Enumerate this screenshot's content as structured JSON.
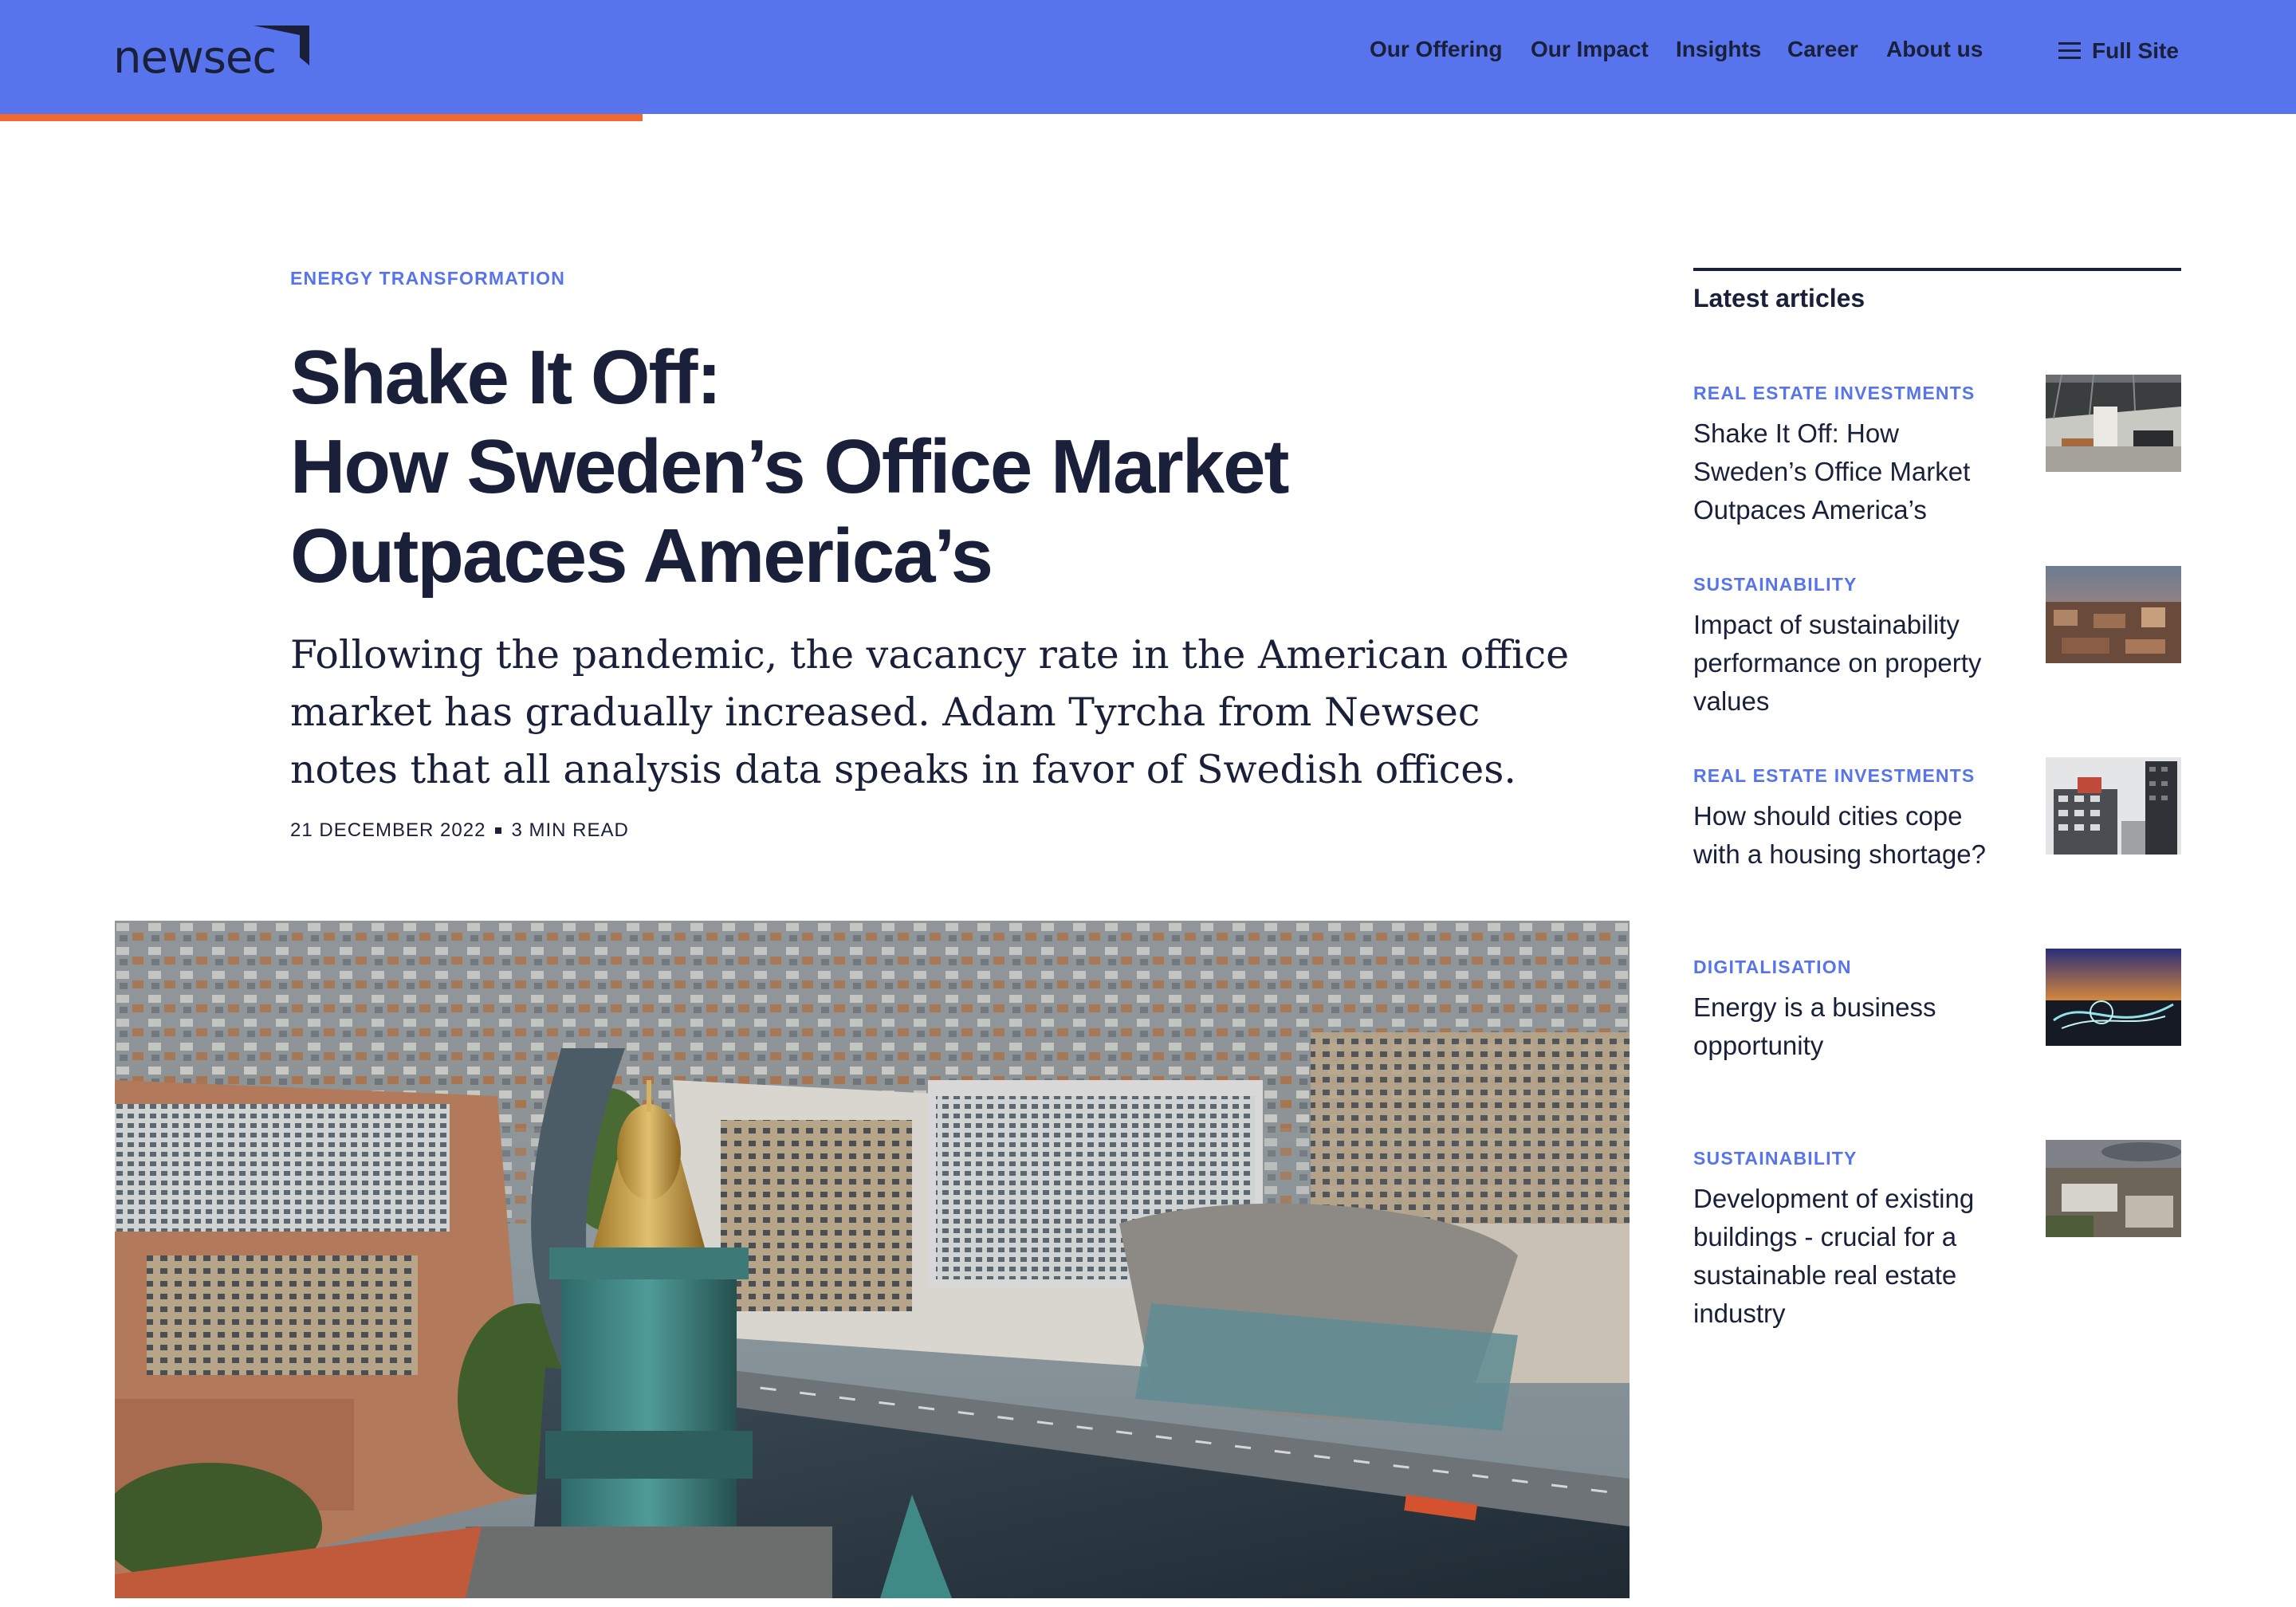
{
  "header": {
    "logo_text": "newsec",
    "nav": [
      {
        "label": "Our Offering"
      },
      {
        "label": "Our Impact"
      },
      {
        "label": "Insights"
      },
      {
        "label": "Career"
      },
      {
        "label": "About us"
      }
    ],
    "full_site_label": "Full Site",
    "menu_icon": "hamburger-icon",
    "reading_progress": 0.28
  },
  "article": {
    "category": "ENERGY TRANSFORMATION",
    "title_lines": [
      "Shake It Off:",
      "How Sweden’s Office Market",
      "Outpaces America’s"
    ],
    "lede": "Following the pandemic, the vacancy rate in the American office market has gradually increased. Adam Tyrcha from Newsec notes that all analysis data speaks in favor of Swedish offices.",
    "date": "21 DECEMBER 2022",
    "read_time": "3 MIN READ"
  },
  "sidebar": {
    "heading": "Latest articles",
    "items": [
      {
        "category": "REAL ESTATE INVESTMENTS",
        "title": "Shake It Off: How Sweden’s Office Market Outpaces America’s"
      },
      {
        "category": "SUSTAINABILITY",
        "title": "Impact of sustainability performance on property values"
      },
      {
        "category": "REAL ESTATE INVESTMENTS",
        "title": "How should cities cope with a housing shortage?"
      },
      {
        "category": "DIGITALISATION",
        "title": "Energy is a business opportunity"
      },
      {
        "category": "SUSTAINABILITY",
        "title": "Development of existing buildings - crucial for a sustainable real estate industry"
      }
    ]
  },
  "colors": {
    "header_bg": "#5774ec",
    "accent_orange": "#ef6a33",
    "text_dark": "#1a1f3a",
    "category_blue": "#5774ec"
  }
}
